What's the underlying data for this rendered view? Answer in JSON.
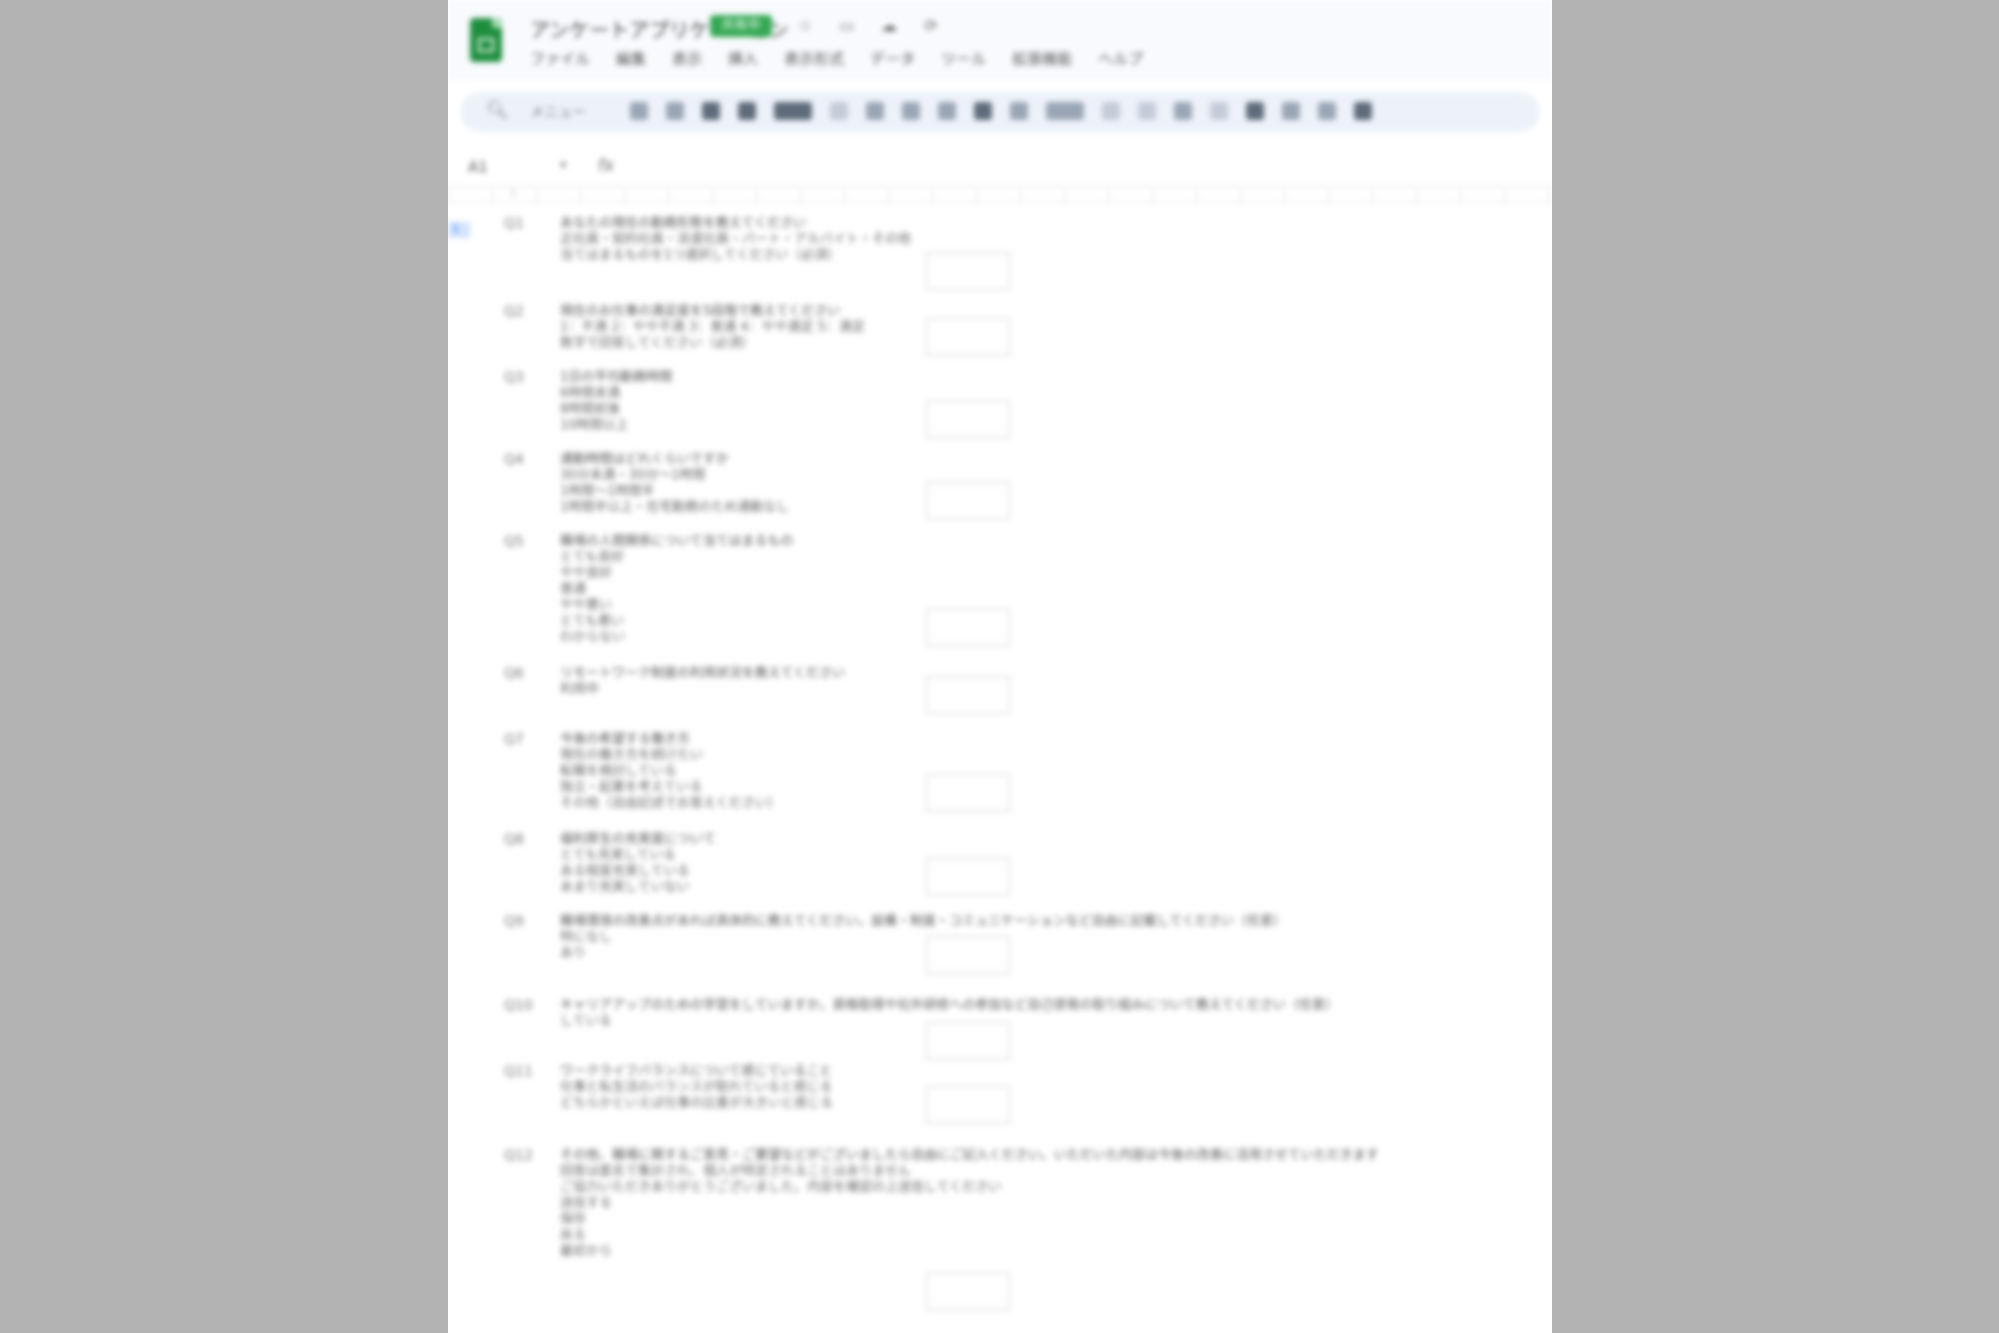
{
  "app": {
    "title": "アンケートアプリケーション",
    "badge": "共有中",
    "title_icons": [
      "star-icon",
      "move-icon",
      "cloud-icon",
      "history-icon"
    ],
    "menu": [
      "ファイル",
      "編集",
      "表示",
      "挿入",
      "表示形式",
      "データ",
      "ツール",
      "拡張機能",
      "ヘルプ"
    ]
  },
  "toolbar": {
    "menu_label": "メニュー",
    "zoom": "100%"
  },
  "formula_bar": {
    "cell_ref": "A1",
    "fx": "fx"
  },
  "grid": {
    "header_number": "1",
    "selected_row": "1"
  },
  "questions": [
    {
      "num": "Q1",
      "lines": [
        "あなたの現在の勤務形態を教えてください",
        "正社員・契約社員・派遣社員・パート・アルバイト・その他",
        "当てはまるものを1つ選択してください（必須）"
      ]
    },
    {
      "num": "Q2",
      "lines": [
        "現在のお仕事の満足度を5段階で教えてください",
        "1：不満 2：やや不満 3：普通 4：やや満足 5：満足",
        "数字で回答してください（必須）"
      ]
    },
    {
      "num": "Q3",
      "lines": [
        "1日の平均勤務時間",
        "6時間未満",
        "8時間前後",
        "10時間以上"
      ]
    },
    {
      "num": "Q4",
      "lines": [
        "通勤時間はどれくらいですか",
        "30分未満・30分〜1時間",
        "1時間〜1時間半",
        "1時間半以上・在宅勤務のため通勤なし"
      ]
    },
    {
      "num": "Q5",
      "lines": [
        "職場の人間関係について当てはまるもの",
        "とても良好",
        "やや良好",
        "普通",
        "やや悪い",
        "とても悪い",
        "わからない"
      ]
    },
    {
      "num": "Q6",
      "lines": [
        "リモートワーク制度の利用状況を教えてください",
        "利用中"
      ]
    },
    {
      "num": "Q7",
      "lines": [
        "今後の希望する働き方",
        "現在の働き方を続けたい",
        "転職を検討している",
        "独立・起業を考えている",
        "その他（自由記述でお答えください）"
      ]
    },
    {
      "num": "Q8",
      "lines": [
        "福利厚生の充実度について",
        "とても充実している",
        "ある程度充実している",
        "あまり充実していない"
      ]
    },
    {
      "num": "Q9",
      "lines": [
        "職場環境の改善点があれば具体的に教えてください。設備・制度・コミュニケーションなど自由に記載してください（任意）",
        "特になし",
        "あり"
      ]
    },
    {
      "num": "Q10",
      "lines": [
        "キャリアアップのための学習をしていますか。資格取得や社外研修への参加など自己啓発の取り組みについて教えてください（任意）",
        "している"
      ]
    },
    {
      "num": "Q11",
      "lines": [
        "ワークライフバランスについて感じていること",
        "仕事と私生活のバランスが取れていると感じる",
        "どちらかといえば仕事の比重が大きいと感じる"
      ]
    },
    {
      "num": "Q12",
      "lines": [
        "その他、職場に関するご意見・ご要望などがございましたら自由にご記入ください。いただいた内容は今後の改善に活用させていただきます",
        "回答は匿名で集計され、個人が特定されることはありません",
        "ご協力いただきありがとうございました。内容を確認の上送信してください",
        "送信する",
        "保存",
        "戻る",
        "最初から"
      ]
    }
  ]
}
